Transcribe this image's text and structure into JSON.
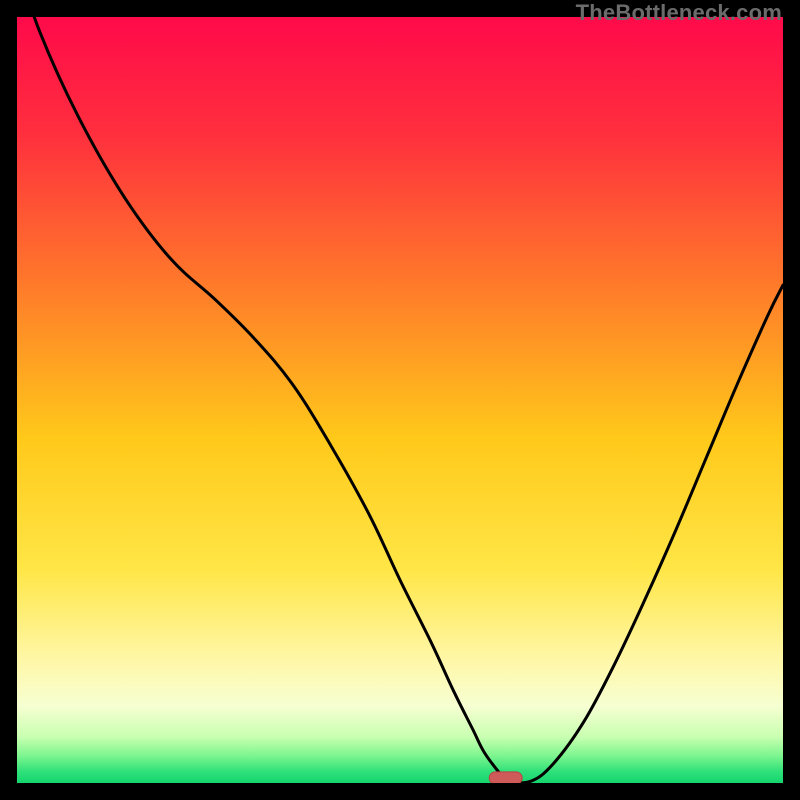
{
  "watermark": "TheBottleneck.com",
  "colors": {
    "frame_black": "#000000",
    "watermark_gray": "#6b6b6b",
    "gradient_stops": [
      {
        "offset": 0.0,
        "color": "#ff0a4a"
      },
      {
        "offset": 0.15,
        "color": "#ff2e3e"
      },
      {
        "offset": 0.35,
        "color": "#ff7a2a"
      },
      {
        "offset": 0.55,
        "color": "#ffc91a"
      },
      {
        "offset": 0.72,
        "color": "#ffe646"
      },
      {
        "offset": 0.84,
        "color": "#fff7a8"
      },
      {
        "offset": 0.9,
        "color": "#f6ffd2"
      },
      {
        "offset": 0.94,
        "color": "#c8ffb0"
      },
      {
        "offset": 0.965,
        "color": "#7bf58e"
      },
      {
        "offset": 0.985,
        "color": "#2fe07a"
      },
      {
        "offset": 1.0,
        "color": "#14d66e"
      }
    ],
    "curve_stroke": "#000000",
    "marker_fill": "#cf5a5a",
    "marker_stroke": "#b94343"
  },
  "chart_data": {
    "type": "line",
    "title": "",
    "xlabel": "",
    "ylabel": "",
    "xlim": [
      0,
      100
    ],
    "ylim": [
      0,
      100
    ],
    "x": [
      0,
      3,
      8,
      14,
      20,
      26,
      31,
      36,
      41,
      46,
      50,
      54,
      57,
      59.5,
      61,
      63,
      64,
      67,
      70,
      74,
      78,
      82,
      86,
      90,
      94,
      98,
      100
    ],
    "values": [
      107,
      98,
      87,
      76.5,
      68.5,
      63,
      58,
      52,
      44,
      35,
      26.5,
      18.5,
      12,
      7,
      4,
      1.3,
      0.3,
      0.2,
      2.5,
      8,
      15.5,
      24,
      33,
      42.5,
      52,
      61,
      65
    ],
    "annotations": [
      {
        "kind": "marker-pill",
        "x": 63.8,
        "y": 0.65,
        "width_pct": 4.3,
        "height_pct": 1.6
      }
    ]
  }
}
